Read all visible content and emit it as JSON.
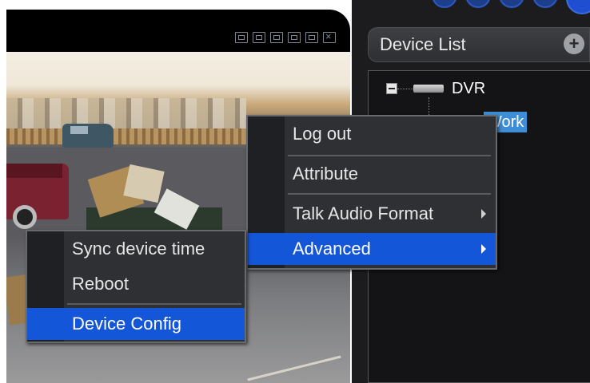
{
  "device_list": {
    "title": "Device List",
    "add_icon": "plus-circle-icon",
    "tree": {
      "root_label": "DVR",
      "child_label": "Work"
    }
  },
  "video_toolbar": {
    "icons": [
      "single-view-icon",
      "multi-view-icon",
      "record-icon",
      "snapshot-icon",
      "audio-icon",
      "close-icon"
    ]
  },
  "context_menu": {
    "items": [
      "Log out",
      "Attribute",
      "Talk Audio Format",
      "Advanced"
    ],
    "active_item": "Advanced"
  },
  "submenu": {
    "items": [
      "Sync device time",
      "Reboot",
      "Device Config"
    ],
    "active_item": "Device Config"
  },
  "colors": {
    "menu_bg": "#2f3034",
    "highlight": "#1456d8",
    "tree_selection": "#3d8ed6"
  }
}
